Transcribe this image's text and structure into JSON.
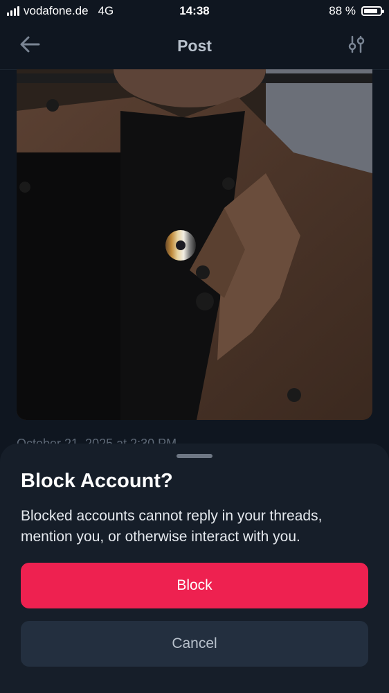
{
  "status_bar": {
    "carrier": "vodafone.de",
    "network": "4G",
    "time": "14:38",
    "battery": "88 %",
    "battery_level": 0.88
  },
  "nav": {
    "title": "Post",
    "back_icon": "arrow-left-icon",
    "filter_icon": "sliders-icon"
  },
  "post": {
    "timestamp": "October 21, 2025 at 2:30 PM"
  },
  "sheet": {
    "title": "Block Account?",
    "message": "Blocked accounts cannot reply in your threads, mention you, or otherwise interact with you.",
    "block_label": "Block",
    "cancel_label": "Cancel"
  },
  "colors": {
    "background": "#0f1620",
    "sheet": "#161e29",
    "accent_red": "#ee2150",
    "cancel_button": "#232f3f"
  }
}
